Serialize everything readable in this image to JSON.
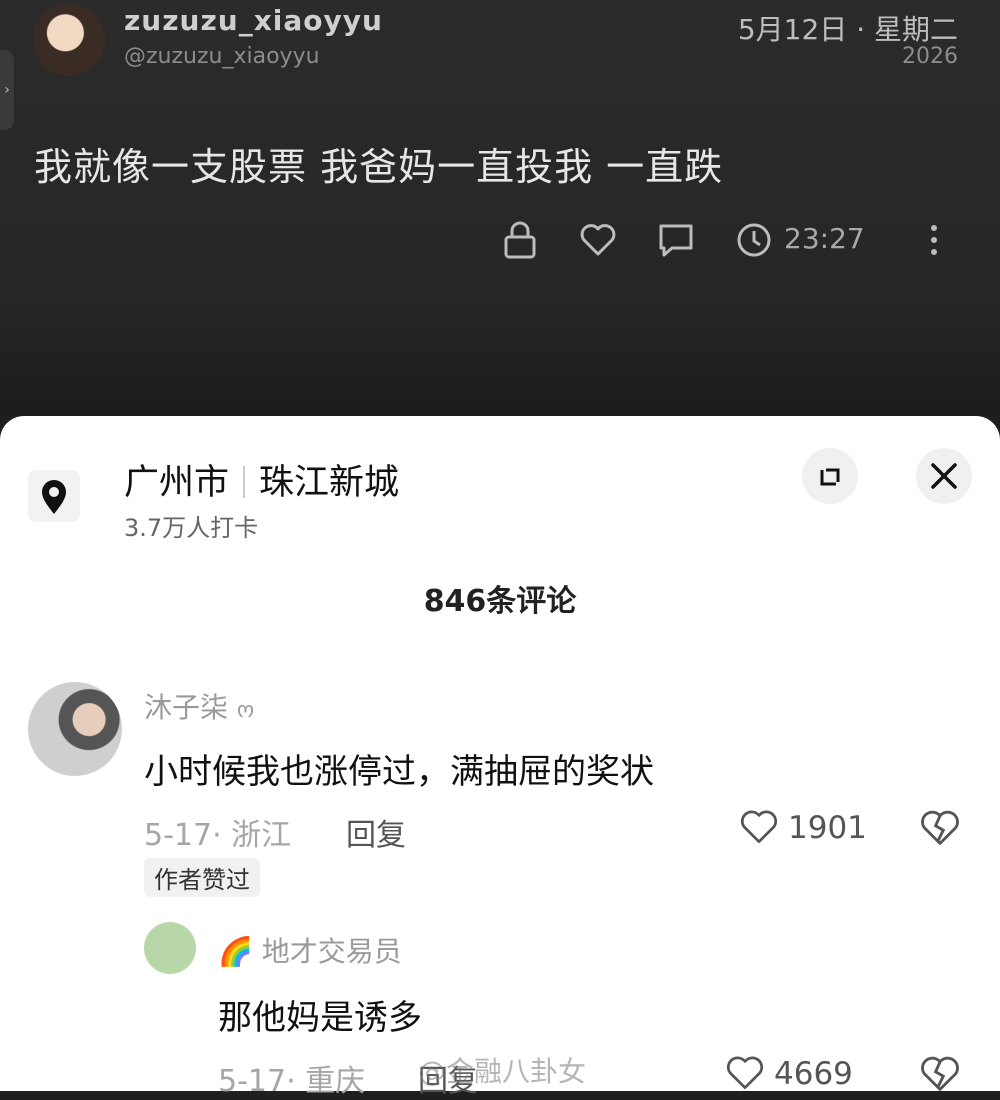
{
  "post": {
    "username": "zuzuzu_xiaoyyu",
    "handle": "@zuzuzu_xiaoyyu",
    "date": "5月12日 · 星期二",
    "year": "2026",
    "text": "我就像一支股票 我爸妈一直投我 一直跌",
    "time": "23:27"
  },
  "location": {
    "city": "广州市",
    "area": "珠江新城",
    "checkins": "3.7万人打卡"
  },
  "comment_count": "846条评论",
  "comments": [
    {
      "name": "沐子柒",
      "name_suffix": "ო",
      "text": "小时候我也涨停过，满抽屉的奖状",
      "meta": "5-17· 浙江",
      "reply_label": "回复",
      "likes": "1901",
      "badge": "作者赞过"
    },
    {
      "name": "地才交易员",
      "text": "那他妈是诱多",
      "meta": "5-17· 重庆",
      "reply_label": "回复",
      "likes": "4669"
    }
  ],
  "watermark": "@金融八卦女",
  "colors": {
    "post_background": "#262626",
    "sheet_background": "#ffffff",
    "icon_light": "#bcbcbc"
  }
}
